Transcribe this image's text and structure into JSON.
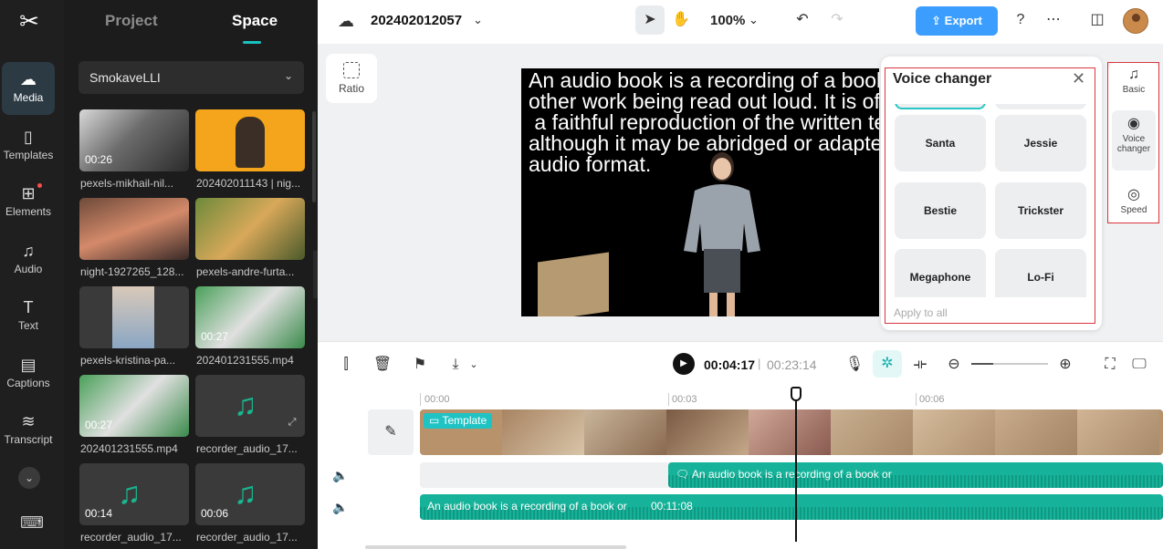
{
  "rail": {
    "items": [
      {
        "label": "Media",
        "icon": "media-icon"
      },
      {
        "label": "Templates",
        "icon": "templates-icon"
      },
      {
        "label": "Elements",
        "icon": "elements-icon"
      },
      {
        "label": "Audio",
        "icon": "audio-icon"
      },
      {
        "label": "Text",
        "icon": "text-icon"
      },
      {
        "label": "Captions",
        "icon": "captions-icon"
      },
      {
        "label": "Transcript",
        "icon": "transcript-icon"
      }
    ]
  },
  "panel": {
    "tabs": [
      "Project",
      "Space"
    ],
    "space_name": "SmokaveLLI",
    "media": [
      {
        "label": "pexels-mikhail-nil...",
        "duration": "00:26"
      },
      {
        "label": "202402011143 | nig...",
        "duration": ""
      },
      {
        "label": "night-1927265_128...",
        "duration": ""
      },
      {
        "label": "pexels-andre-furta...",
        "duration": ""
      },
      {
        "label": "pexels-kristina-pa...",
        "duration": ""
      },
      {
        "label": "202401231555.mp4",
        "duration": "00:27"
      },
      {
        "label": "202401231555.mp4",
        "duration": "00:27"
      },
      {
        "label": "recorder_audio_17...",
        "duration": ""
      },
      {
        "label": "recorder_audio_17...",
        "duration": "00:14"
      },
      {
        "label": "recorder_audio_17...",
        "duration": "00:06"
      }
    ]
  },
  "topbar": {
    "project_name": "202402012057",
    "zoom": "100%",
    "export_label": "Export"
  },
  "preview": {
    "ratio_label": "Ratio",
    "overlay_text": "An audio book is a recording of a book or\nother work being read out loud. It is often\n a faithful reproduction of the written text,\nalthough it may be abridged or adapted for\naudio format."
  },
  "voice_changer": {
    "title": "Voice changer",
    "options": [
      "",
      "",
      "Santa",
      "Jessie",
      "Bestie",
      "Trickster",
      "Megaphone",
      "Lo-Fi"
    ],
    "apply_label": "Apply to all"
  },
  "prop_tabs": [
    {
      "label": "Basic",
      "icon": "basic-icon"
    },
    {
      "label": "Voice changer",
      "icon": "voice-changer-icon"
    },
    {
      "label": "Speed",
      "icon": "speed-icon"
    }
  ],
  "timeline": {
    "current_time": "00:04:17",
    "separator": "|",
    "total_time": "00:23:14",
    "ruler": [
      "00:00",
      "00:03",
      "00:06"
    ],
    "template_label": "Template",
    "audio_caption_1": "An audio book is a recording of a book or",
    "audio_caption_2": "An audio book is a recording of a book or",
    "audio_duration": "00:11:08"
  }
}
